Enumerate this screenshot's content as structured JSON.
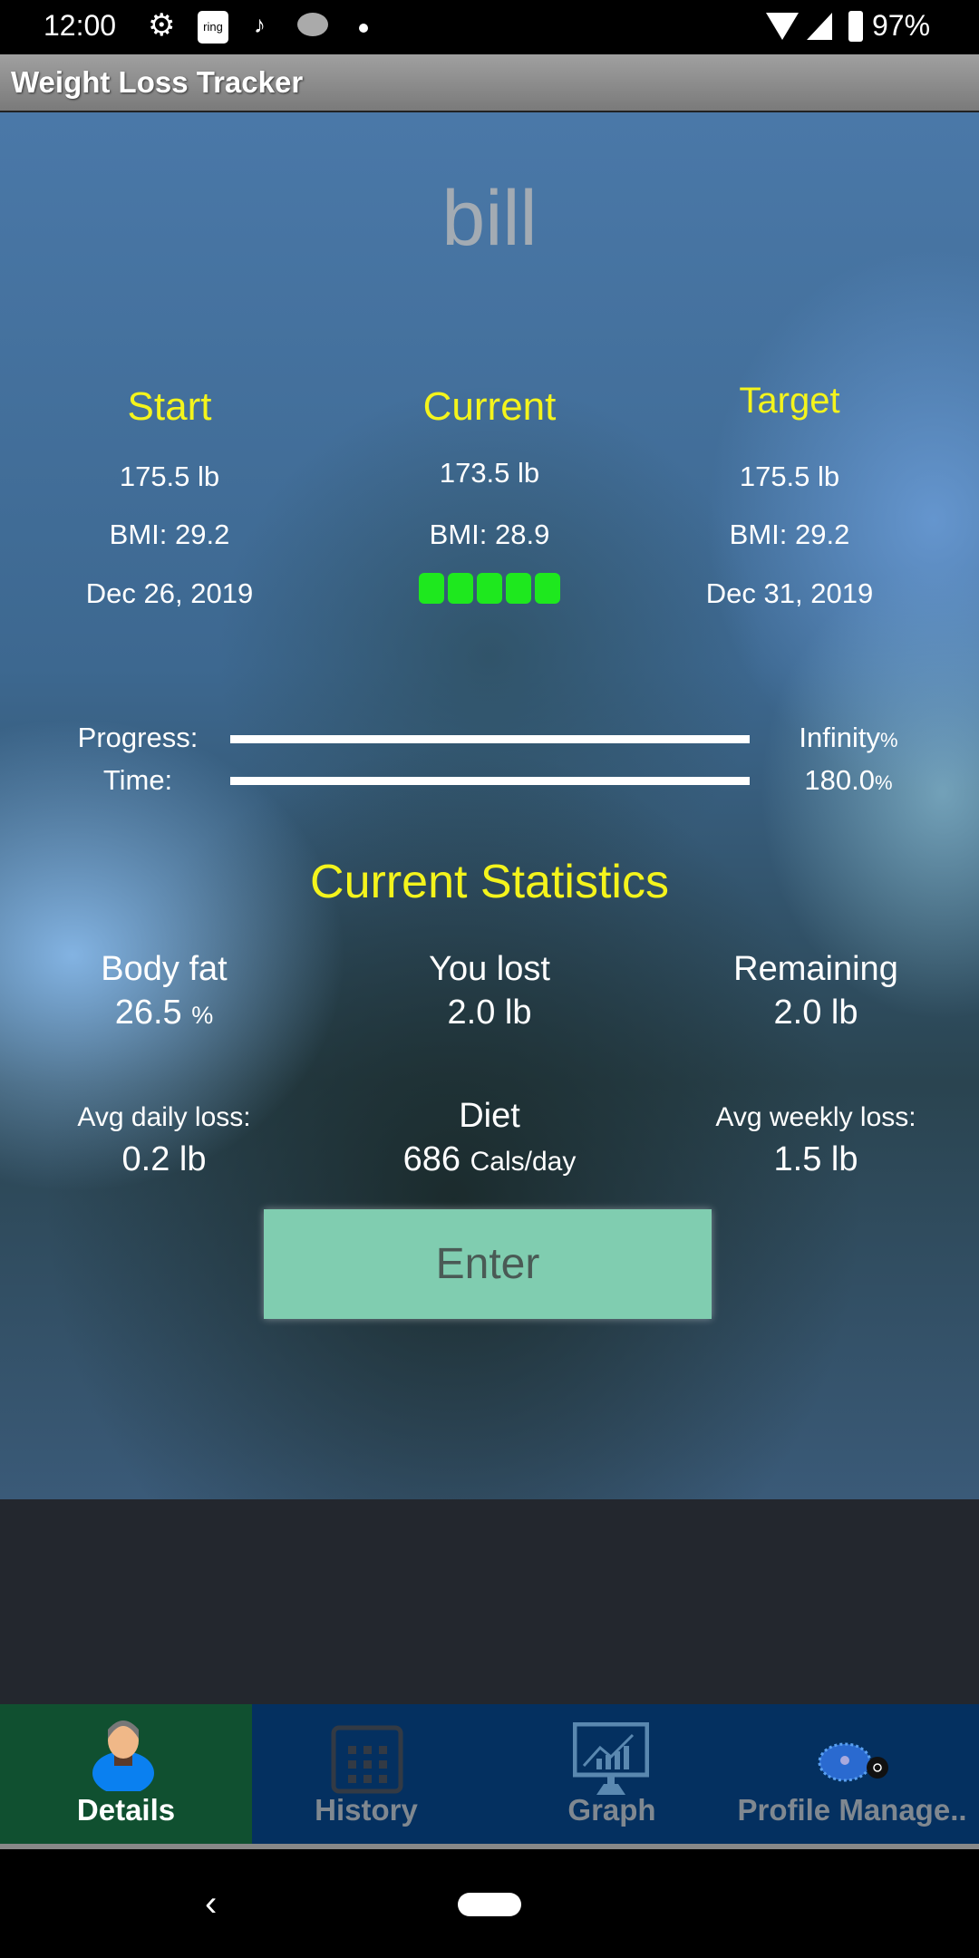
{
  "status_bar": {
    "time": "12:00",
    "battery": "97%",
    "icons": [
      "gear-icon",
      "ring-icon",
      "tiktok-icon",
      "piggy-bank-icon",
      "dot-icon",
      "wifi-icon",
      "signal-icon",
      "battery-icon"
    ]
  },
  "app": {
    "title": "Weight Loss Tracker"
  },
  "profile": {
    "name": "bill"
  },
  "columns": [
    {
      "heading": "Start",
      "weight": "175.5 lb",
      "bmi": "BMI: 29.2",
      "date": "Dec 26, 2019"
    },
    {
      "heading": "Current",
      "weight": "173.5 lb",
      "bmi": "BMI: 28.9",
      "rating_dots": 5
    },
    {
      "heading": "Target",
      "weight": "175.5 lb",
      "bmi": "BMI: 29.2",
      "date": "Dec 31, 2019"
    }
  ],
  "progress": {
    "label": "Progress:",
    "value": "Infinity",
    "unit": "%",
    "fill": 1.0
  },
  "time": {
    "label": "Time:",
    "value": "180.0",
    "unit": "%",
    "fill": 1.0
  },
  "stats": {
    "title": "Current Statistics",
    "body_fat": {
      "label": "Body fat",
      "value": "26.5",
      "unit": "%"
    },
    "lost": {
      "label": "You lost",
      "value": "2.0 lb"
    },
    "remaining": {
      "label": "Remaining",
      "value": "2.0 lb"
    },
    "avg_daily": {
      "label": "Avg daily loss:",
      "value": "0.2 lb"
    },
    "diet": {
      "label": "Diet",
      "value": "686",
      "unit": "Cals/day"
    },
    "avg_weekly": {
      "label": "Avg weekly loss:",
      "value": "1.5 lb"
    }
  },
  "enter_label": "Enter",
  "tabs": [
    {
      "label": "Details",
      "active": true
    },
    {
      "label": "History"
    },
    {
      "label": "Graph"
    },
    {
      "label": "Profile Manage.."
    }
  ],
  "colors": {
    "accent_yellow": "#f4f41c",
    "dots_green": "#1ee81e",
    "enter_button": "#80cdb0",
    "nav_bg": "#043060",
    "active_tab": "#105030"
  }
}
